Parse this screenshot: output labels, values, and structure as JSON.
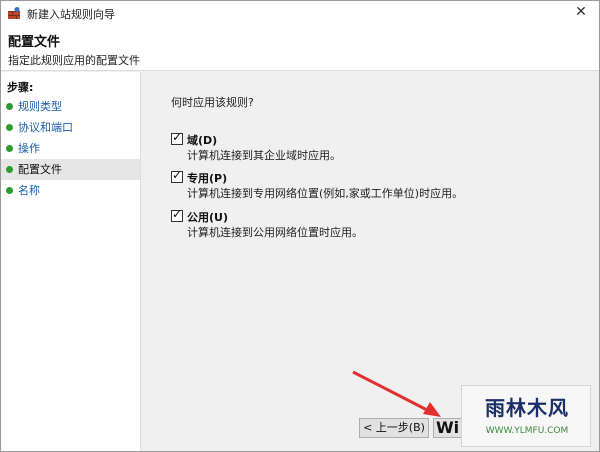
{
  "window": {
    "title": "新建入站规则向导",
    "close_glyph": "✕"
  },
  "header": {
    "title": "配置文件",
    "subtitle": "指定此规则应用的配置文件"
  },
  "sidebar": {
    "heading": "步骤:",
    "items": [
      {
        "label": "规则类型",
        "state": "link"
      },
      {
        "label": "协议和端口",
        "state": "link"
      },
      {
        "label": "操作",
        "state": "link"
      },
      {
        "label": "配置文件",
        "state": "active"
      },
      {
        "label": "名称",
        "state": "link"
      }
    ]
  },
  "main": {
    "question": "何时应用该规则?",
    "options": [
      {
        "label": "域(D)",
        "description": "计算机连接到其企业域时应用。",
        "checked": true
      },
      {
        "label": "专用(P)",
        "description": "计算机连接到专用网络位置(例如,家或工作单位)时应用。",
        "checked": true
      },
      {
        "label": "公用(U)",
        "description": "计算机连接到公用网络位置时应用。",
        "checked": true
      }
    ]
  },
  "buttons": {
    "back": "< 上一步(B)",
    "next": "Wi"
  },
  "watermark": {
    "logo": "雨林木风",
    "url": "WWW.YLMFU.COM"
  },
  "colors": {
    "link": "#1a5ea8",
    "step_dot": "#2f9b2f",
    "arrow": "#e23030"
  }
}
